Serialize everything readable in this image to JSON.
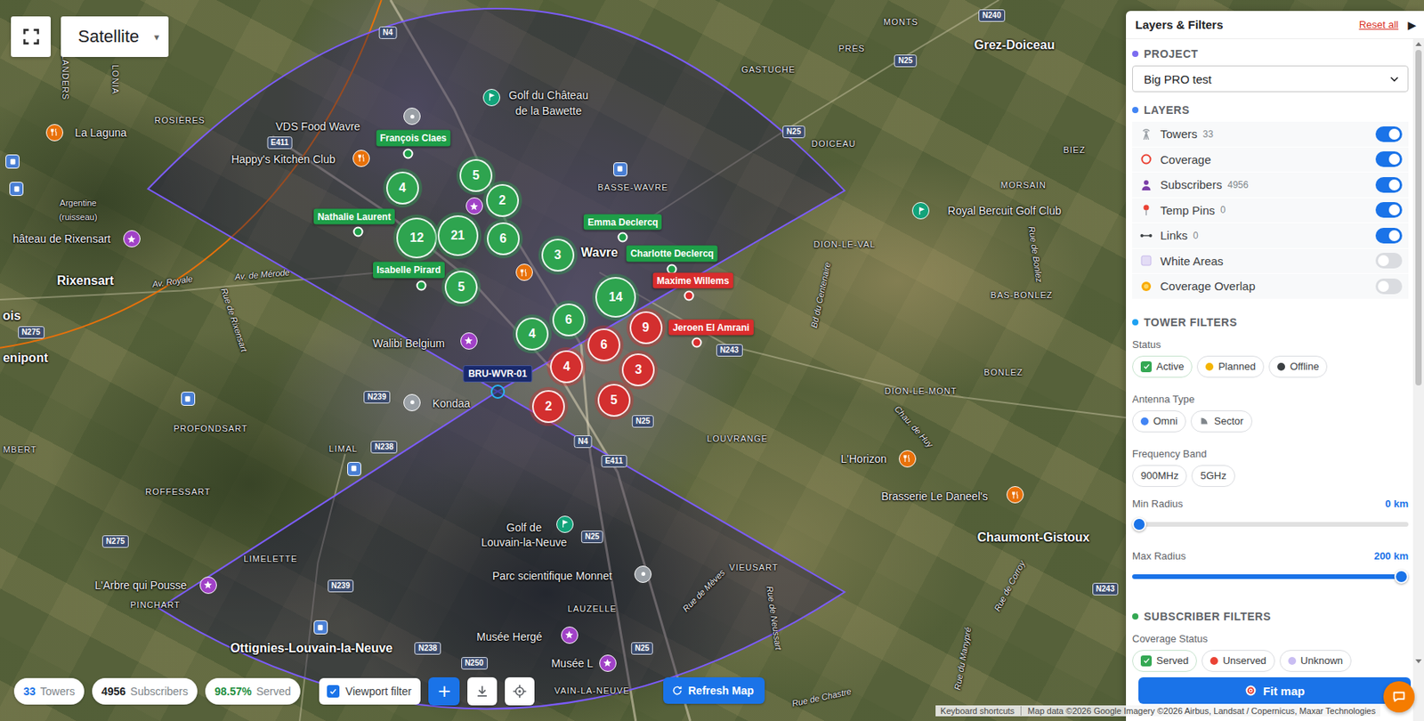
{
  "map": {
    "type_selector": {
      "label": "Satellite",
      "caret": "▾"
    },
    "places": [
      {
        "text": "FLANDERS",
        "kind": "district"
      },
      {
        "text": "LONIA",
        "kind": "district"
      },
      {
        "text": "ROSIÈRES",
        "kind": "district"
      },
      {
        "text": "La Laguna",
        "kind": "poi"
      },
      {
        "text": "VDS Food Wavre",
        "kind": "poi"
      },
      {
        "text": "Happy's Kitchen Club",
        "kind": "poi"
      },
      {
        "text": "Argentine",
        "kind": "minor"
      },
      {
        "text": "(ruisseau)",
        "kind": "minor"
      },
      {
        "text": "hâteau de Rixensart",
        "kind": "poi"
      },
      {
        "text": "Rixensart",
        "kind": "town"
      },
      {
        "text": "Av. Royale",
        "kind": "street"
      },
      {
        "text": "Av. de Mérode",
        "kind": "street"
      },
      {
        "text": "Rue de Rixensart",
        "kind": "street"
      },
      {
        "text": "ois",
        "kind": "town"
      },
      {
        "text": "enipont",
        "kind": "town"
      },
      {
        "text": "Walibi Belgium",
        "kind": "poi"
      },
      {
        "text": "Kondaa",
        "kind": "poi"
      },
      {
        "text": "PROFONDSART",
        "kind": "district"
      },
      {
        "text": "MBERT",
        "kind": "district"
      },
      {
        "text": "LIMAL",
        "kind": "district"
      },
      {
        "text": "ROFFESSART",
        "kind": "district"
      },
      {
        "text": "LIMELETTE",
        "kind": "district"
      },
      {
        "text": "L'Arbre qui Pousse",
        "kind": "poi"
      },
      {
        "text": "PINCHART",
        "kind": "district"
      },
      {
        "text": "Ottignies-Louvain-la-Neuve",
        "kind": "town"
      },
      {
        "text": "Golf du Château",
        "kind": "poi"
      },
      {
        "text": "de la Bawette",
        "kind": "poi"
      },
      {
        "text": "Wavre",
        "kind": "town"
      },
      {
        "text": "BASSE-WAVRE",
        "kind": "district"
      },
      {
        "text": "Golf de",
        "kind": "poi"
      },
      {
        "text": "Louvain-la-Neuve",
        "kind": "poi"
      },
      {
        "text": "Parc scientifique Monnet",
        "kind": "poi"
      },
      {
        "text": "LAUZELLE",
        "kind": "district"
      },
      {
        "text": "Musée Hergé",
        "kind": "poi"
      },
      {
        "text": "Musée L",
        "kind": "poi"
      },
      {
        "text": "VAIN-LA-NEUVE",
        "kind": "district"
      },
      {
        "text": "GASTUCHE",
        "kind": "district"
      },
      {
        "text": "PRÈS",
        "kind": "district"
      },
      {
        "text": "MONTS",
        "kind": "district"
      },
      {
        "text": "Grez-Doiceau",
        "kind": "town"
      },
      {
        "text": "DOICEAU",
        "kind": "district"
      },
      {
        "text": "BIEZ",
        "kind": "district"
      },
      {
        "text": "MORSAIN",
        "kind": "district"
      },
      {
        "text": "Royal Bercuit Golf Club",
        "kind": "poi"
      },
      {
        "text": "DION-LE-VAL",
        "kind": "district"
      },
      {
        "text": "BAS-BONLEZ",
        "kind": "district"
      },
      {
        "text": "BONLEZ",
        "kind": "district"
      },
      {
        "text": "DION-LE-MONT",
        "kind": "district"
      },
      {
        "text": "LOUVRANGE",
        "kind": "district"
      },
      {
        "text": "L'Horizon",
        "kind": "poi"
      },
      {
        "text": "Brasserie Le Daneel's",
        "kind": "poi"
      },
      {
        "text": "Chaumont-Gistoux",
        "kind": "town"
      },
      {
        "text": "VIEUSART",
        "kind": "district"
      },
      {
        "text": "Bd du Centenaire",
        "kind": "street"
      },
      {
        "text": "Rue de Bonlez",
        "kind": "street"
      },
      {
        "text": "Chau. de Huy",
        "kind": "street"
      },
      {
        "text": "Rue de Mèves",
        "kind": "street"
      },
      {
        "text": "Rue de Neussart",
        "kind": "street"
      },
      {
        "text": "Rue de Corroy",
        "kind": "street"
      },
      {
        "text": "Rue du Manypré",
        "kind": "street"
      },
      {
        "text": "Rue de Chastre",
        "kind": "street"
      }
    ],
    "road_shields": [
      {
        "text": "N4"
      },
      {
        "text": "E411"
      },
      {
        "text": "N275"
      },
      {
        "text": "N239"
      },
      {
        "text": "N238"
      },
      {
        "text": "N275"
      },
      {
        "text": "N239"
      },
      {
        "text": "N238"
      },
      {
        "text": "N250"
      },
      {
        "text": "N25"
      },
      {
        "text": "N25"
      },
      {
        "text": "N4"
      },
      {
        "text": "N25"
      },
      {
        "text": "N243"
      },
      {
        "text": "N25"
      },
      {
        "text": "N25"
      },
      {
        "text": "N240"
      },
      {
        "text": "N243"
      },
      {
        "text": "E411"
      }
    ],
    "pois": [
      {
        "kind": "restaurant",
        "color": "#e8710a"
      },
      {
        "kind": "restaurant",
        "color": "#e8710a"
      },
      {
        "kind": "restaurant",
        "color": "#e8710a"
      },
      {
        "kind": "restaurant",
        "color": "#e8710a"
      },
      {
        "kind": "restaurant",
        "color": "#e8710a"
      },
      {
        "kind": "golf",
        "color": "#12a37a"
      },
      {
        "kind": "golf",
        "color": "#12a37a"
      },
      {
        "kind": "golf",
        "color": "#12a37a"
      },
      {
        "kind": "attraction",
        "color": "#a142c7"
      },
      {
        "kind": "attraction",
        "color": "#a142c7"
      },
      {
        "kind": "attraction",
        "color": "#a142c7"
      },
      {
        "kind": "attraction",
        "color": "#a142c7"
      },
      {
        "kind": "attraction",
        "color": "#a142c7"
      },
      {
        "kind": "attraction",
        "color": "#a142c7"
      },
      {
        "kind": "landmark",
        "color": "#9aa0a6"
      },
      {
        "kind": "landmark",
        "color": "#9aa0a6"
      },
      {
        "kind": "landmark",
        "color": "#9aa0a6"
      },
      {
        "kind": "transit",
        "color": "#4a7fd4"
      },
      {
        "kind": "transit",
        "color": "#4a7fd4"
      },
      {
        "kind": "transit",
        "color": "#4a7fd4"
      },
      {
        "kind": "transit",
        "color": "#4a7fd4"
      },
      {
        "kind": "transit",
        "color": "#4a7fd4"
      },
      {
        "kind": "transit",
        "color": "#4a7fd4"
      }
    ],
    "tower": {
      "label": "BRU-WVR-01"
    },
    "clusters": [
      {
        "count": "5",
        "color": "#2ea44f"
      },
      {
        "count": "2",
        "color": "#2ea44f"
      },
      {
        "count": "4",
        "color": "#2ea44f"
      },
      {
        "count": "12",
        "color": "#2ea44f"
      },
      {
        "count": "21",
        "color": "#2ea44f"
      },
      {
        "count": "6",
        "color": "#2ea44f"
      },
      {
        "count": "3",
        "color": "#2ea44f"
      },
      {
        "count": "5",
        "color": "#2ea44f"
      },
      {
        "count": "14",
        "color": "#2ea44f"
      },
      {
        "count": "6",
        "color": "#2ea44f"
      },
      {
        "count": "4",
        "color": "#2ea44f"
      },
      {
        "count": "9",
        "color": "#d32f2f"
      },
      {
        "count": "6",
        "color": "#d32f2f"
      },
      {
        "count": "4",
        "color": "#d32f2f"
      },
      {
        "count": "3",
        "color": "#d32f2f"
      },
      {
        "count": "2",
        "color": "#d32f2f"
      },
      {
        "count": "5",
        "color": "#d32f2f"
      }
    ],
    "subscribers": [
      {
        "name": "François Claes",
        "served": true,
        "color": "#1e9e48"
      },
      {
        "name": "Nathalie Laurent",
        "served": true,
        "color": "#1e9e48"
      },
      {
        "name": "Isabelle Pirard",
        "served": true,
        "color": "#1e9e48"
      },
      {
        "name": "Emma Declercq",
        "served": true,
        "color": "#1e9e48"
      },
      {
        "name": "Charlotte Declercq",
        "served": true,
        "color": "#1e9e48"
      },
      {
        "name": "Maxime Willems",
        "served": false,
        "color": "#d92d2d"
      },
      {
        "name": "Jeroen El Amrani",
        "served": false,
        "color": "#d92d2d"
      }
    ],
    "attribution": {
      "shortcuts": "Keyboard shortcuts",
      "data": "Map data ©2026 Google Imagery ©2026 Airbus, Landsat / Copernicus, Maxar Technologies"
    }
  },
  "panel": {
    "title": "Layers & Filters",
    "reset": "Reset all",
    "collapse": "▶",
    "project": {
      "heading": "PROJECT",
      "value": "Big PRO test"
    },
    "layers": {
      "heading": "LAYERS",
      "items": [
        {
          "label": "Towers",
          "count": "33",
          "on": true
        },
        {
          "label": "Coverage",
          "on": true
        },
        {
          "label": "Subscribers",
          "count": "4956",
          "on": true
        },
        {
          "label": "Temp Pins",
          "count": "0",
          "on": true
        },
        {
          "label": "Links",
          "count": "0",
          "on": true
        },
        {
          "label": "White Areas",
          "on": false
        },
        {
          "label": "Coverage Overlap",
          "on": false
        }
      ]
    },
    "tower_filters": {
      "heading": "TOWER FILTERS",
      "groups": [
        {
          "label": "Status",
          "chips": [
            {
              "label": "Active",
              "kind": "dot",
              "checked": true,
              "color": "#34a853"
            },
            {
              "label": "Planned",
              "kind": "dot",
              "checked": false,
              "color": "#f4b400"
            },
            {
              "label": "Offline",
              "kind": "dot",
              "checked": false,
              "color": "#3c4043"
            }
          ]
        },
        {
          "label": "Antenna Type",
          "chips": [
            {
              "label": "Omni",
              "kind": "dot",
              "checked": false,
              "color": "#4285f4"
            },
            {
              "label": "Sector",
              "kind": "sector",
              "checked": false,
              "color": "#80868b"
            }
          ]
        },
        {
          "label": "Frequency Band",
          "chips": [
            {
              "label": "900MHz",
              "kind": "plain",
              "checked": false
            },
            {
              "label": "5GHz",
              "kind": "plain",
              "checked": false
            }
          ]
        }
      ],
      "sliders": [
        {
          "label": "Min Radius",
          "reading": "0 km",
          "level": 0
        },
        {
          "label": "Max Radius",
          "reading": "200 km",
          "level": 1
        }
      ]
    },
    "subscriber_filters": {
      "heading": "SUBSCRIBER FILTERS",
      "groups": [
        {
          "label": "Coverage Status",
          "chips": [
            {
              "label": "Served",
              "kind": "dot",
              "checked": true,
              "color": "#34a853"
            },
            {
              "label": "Unserved",
              "kind": "dot",
              "checked": false,
              "color": "#ea4335"
            },
            {
              "label": "Unknown",
              "kind": "dot",
              "checked": false,
              "color": "#c9bdf2"
            }
          ]
        }
      ]
    },
    "fit_button": "Fit map"
  },
  "bottom_bar": {
    "stats": [
      {
        "value": "33",
        "label": "Towers",
        "color": "#1a73e8"
      },
      {
        "value": "4956",
        "label": "Subscribers",
        "color": "#202124"
      },
      {
        "value": "98.57%",
        "label": "Served",
        "color": "#1e8e3e"
      }
    ],
    "viewport_filter": {
      "label": "Viewport filter",
      "checked": true
    },
    "add_button": "+",
    "refresh_button": "Refresh Map"
  }
}
